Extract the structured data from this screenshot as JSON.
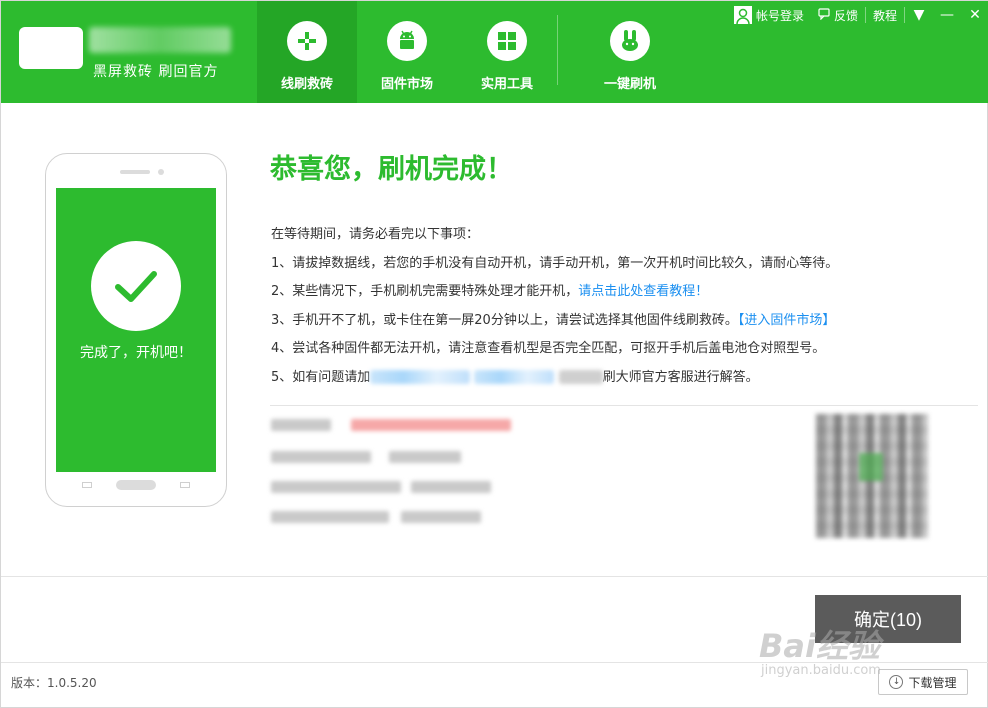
{
  "header": {
    "slogan": "黑屏救砖 刷回官方",
    "nav": [
      {
        "label": "线刷救砖",
        "icon": "plus-icon",
        "active": true
      },
      {
        "label": "固件市场",
        "icon": "android-icon",
        "active": false
      },
      {
        "label": "实用工具",
        "icon": "grid-icon",
        "active": false
      },
      {
        "label": "一键刷机",
        "icon": "rabbit-icon",
        "active": false
      }
    ],
    "topbar": {
      "login": "帐号登录",
      "feedback": "反馈",
      "tutorial": "教程",
      "menu_icon": "▼",
      "minimize_icon": "—",
      "close_icon": "✕"
    },
    "colors": {
      "brand": "#2dbb2f",
      "brand_dark": "#24a626",
      "link": "#1b8ff0"
    }
  },
  "phone": {
    "screen_text": "完成了，开机吧！"
  },
  "message": {
    "title": "恭喜您，刷机完成！",
    "intro": "在等待期间，请务必看完以下事项：",
    "item1": "1、请拔掉数据线，若您的手机没有自动开机，请手动开机，第一次开机时间比较久，请耐心等待。",
    "item2_text": "2、某些情况下，手机刷机完需要特殊处理才能开机，",
    "item2_link": "请点击此处查看教程！",
    "item3_text": "3、手机开不了机，或卡住在第一屏20分钟以上，请尝试选择其他固件线刷救砖。",
    "item3_link": "【进入固件市场】",
    "item4": "4、尝试各种固件都无法开机，请注意查看机型是否完全匹配，可抠开手机后盖电池仓对照型号。",
    "item5_prefix": "5、如有问题请加",
    "item5_suffix": "刷大师官方客服进行解答。"
  },
  "buttons": {
    "confirm": "确定(10)",
    "download_manager": "下载管理"
  },
  "footer": {
    "version": "版本：1.0.5.20"
  },
  "watermark": {
    "text": "Bai经验",
    "sub": "jingyan.baidu.com"
  }
}
